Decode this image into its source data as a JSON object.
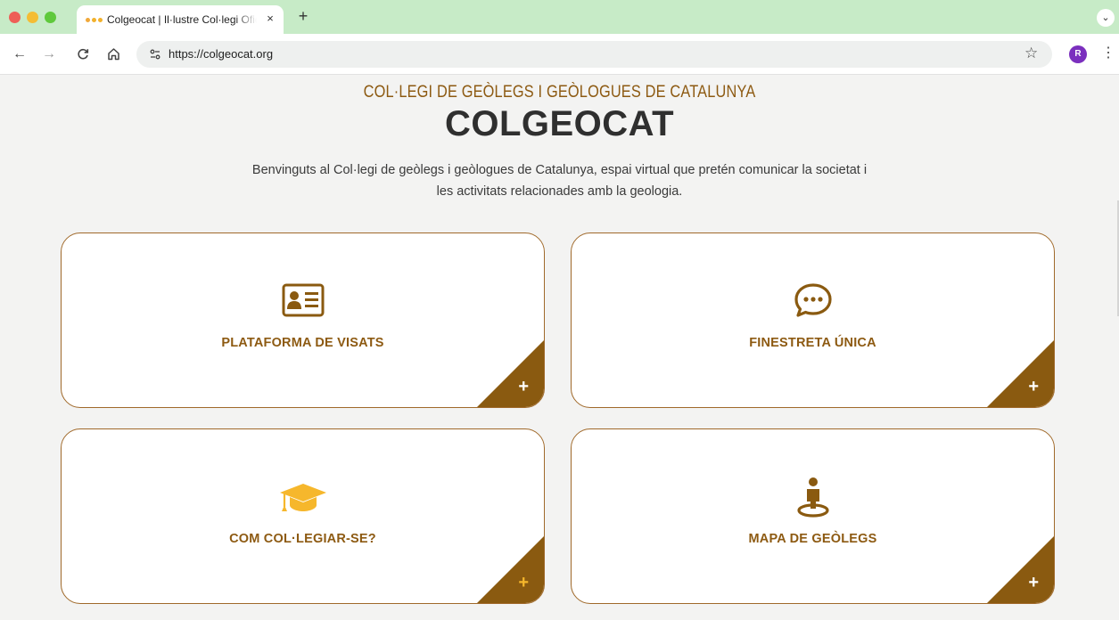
{
  "browser": {
    "tab_title": "Colgeocat | Il·lustre Col·legi Oficial de Geòlegs",
    "tab_close": "×",
    "new_tab": "+",
    "url": "https://colgeocat.org",
    "profile_initial": "R",
    "icons": {
      "back": "←",
      "forward": "→",
      "reload": "C",
      "home": "⌂",
      "site_info": "⊶",
      "bookmark": "☆",
      "menu": "⋮",
      "tab_search": "⌄"
    }
  },
  "header": {
    "supertitle": "COL·LEGI DE GEÒLEGS I GEÒLOGUES DE CATALUNYA",
    "title": "COLGEOCAT",
    "intro_line1": "Benvinguts al Col·legi de geòlegs i geòlogues de Catalunya, espai virtual que pretén comunicar la societat i",
    "intro_line2": "les activitats relacionades amb la geologia."
  },
  "cards": [
    {
      "label": "PLATAFORMA DE VISATS",
      "icon": "id-card-icon",
      "plus": "+"
    },
    {
      "label": "FINESTRETA ÚNICA",
      "icon": "chat-bubble-icon",
      "plus": "+"
    },
    {
      "label": "COM COL·LEGIAR-SE?",
      "icon": "graduation-cap-icon",
      "plus": "+"
    },
    {
      "label": "MAPA DE GEÒLEGS",
      "icon": "map-person-icon",
      "plus": "+"
    }
  ],
  "colors": {
    "brand_brown": "#8a5a10",
    "brand_gold": "#f6b72c",
    "tabbar_green": "#c7ebc7"
  }
}
